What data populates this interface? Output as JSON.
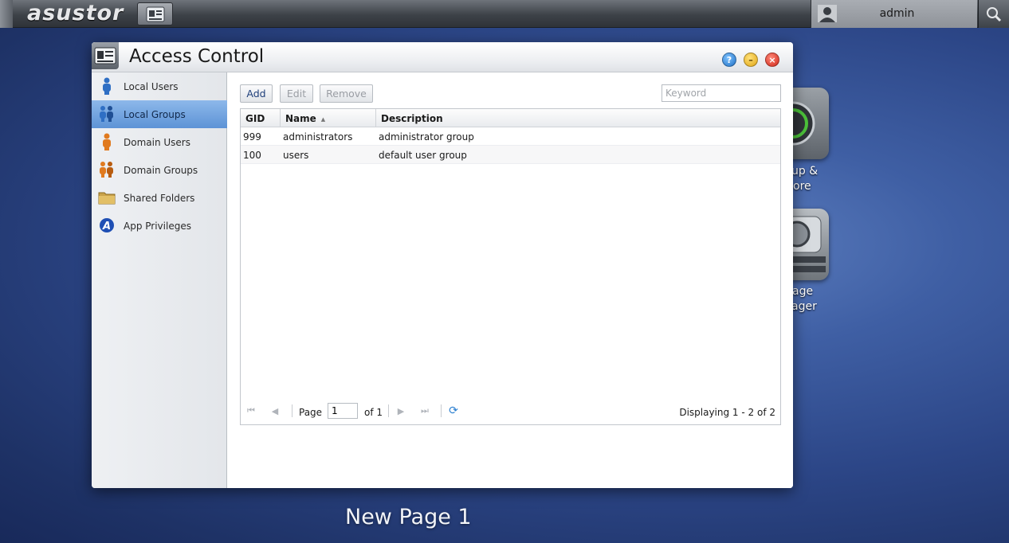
{
  "topbar": {
    "logo": "asustor",
    "user": "admin",
    "icons": [
      "taskbar-app-icon",
      "user-avatar-icon",
      "search-icon"
    ]
  },
  "desktop": {
    "icons": [
      {
        "name": "backup-restore",
        "label_line1": "up &",
        "label_line2": "ore"
      },
      {
        "name": "storage-manager",
        "label_line1": "age",
        "label_line2": "ager"
      }
    ],
    "page_label": "New Page 1"
  },
  "window": {
    "title": "Access Control",
    "buttons": {
      "help": "?",
      "minimize": "–",
      "close": "×"
    }
  },
  "sidebar": {
    "items": [
      {
        "label": "Local Users",
        "icon": "user-icon",
        "active": false
      },
      {
        "label": "Local Groups",
        "icon": "group-icon",
        "active": true
      },
      {
        "label": "Domain Users",
        "icon": "domain-user-icon",
        "active": false
      },
      {
        "label": "Domain Groups",
        "icon": "domain-group-icon",
        "active": false
      },
      {
        "label": "Shared Folders",
        "icon": "folder-icon",
        "active": false
      },
      {
        "label": "App Privileges",
        "icon": "app-privileges-icon",
        "active": false
      }
    ]
  },
  "toolbar": {
    "add": "Add",
    "edit": "Edit",
    "remove": "Remove",
    "keyword_placeholder": "Keyword"
  },
  "table": {
    "columns": [
      "GID",
      "Name",
      "Description"
    ],
    "sort_column": "Name",
    "rows": [
      {
        "gid": "999",
        "name": "administrators",
        "description": "administrator group"
      },
      {
        "gid": "100",
        "name": "users",
        "description": "default user group"
      }
    ]
  },
  "pager": {
    "page_label": "Page",
    "current_page": "1",
    "of_label": "of 1",
    "display": "Displaying 1 - 2 of 2"
  },
  "colors": {
    "active_item": "#5d93d6",
    "desktop_bg": "#2c4687",
    "add_text": "#1e3f7a"
  }
}
